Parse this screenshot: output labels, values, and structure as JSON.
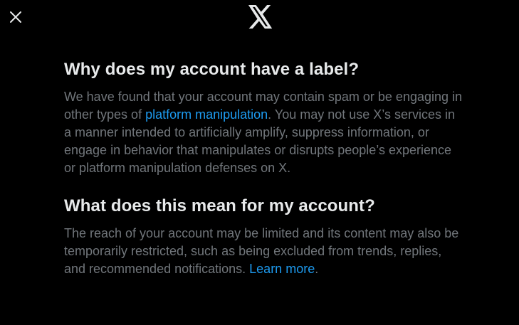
{
  "header": {
    "close_icon": "close-icon",
    "logo_icon": "x-logo-icon"
  },
  "section1": {
    "heading": "Why does my account have a label?",
    "text_before": "We have found that your account may contain spam or be engaging in other types of ",
    "link": "platform manipulation",
    "text_after": ". You may not use X’s services in a manner intended to artificially amplify, suppress information, or engage in behavior that manipulates or disrupts people’s experience or platform manipulation defenses on X."
  },
  "section2": {
    "heading": "What does this mean for my account?",
    "text_before": "The reach of your account may be limited and its content may also be temporarily restricted, such as being excluded from trends, replies, and recommended notifications. ",
    "link": "Learn more",
    "text_after": "."
  },
  "colors": {
    "background": "#000000",
    "heading": "#e7e9ea",
    "body_text": "#71767b",
    "link": "#1d9bf0"
  }
}
